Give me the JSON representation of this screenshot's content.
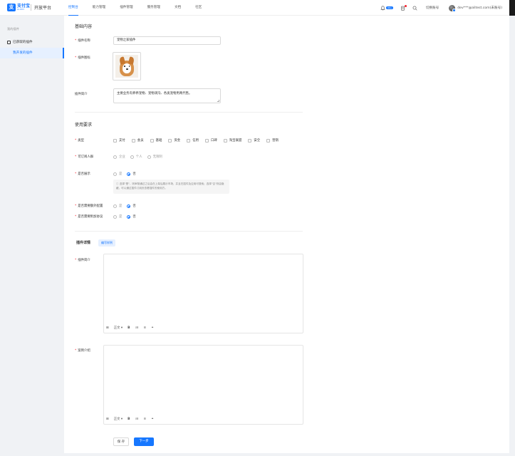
{
  "header": {
    "logo_glyph": "支",
    "logo_name": "支付宝",
    "logo_sub": "ALIPAY",
    "platform": "开放平台",
    "nav": [
      "控制台",
      "能力管理",
      "插件管理",
      "服务管理",
      "文档",
      "社区"
    ],
    "active_nav": 0,
    "msg_badge": "99+",
    "switch_account": "切换账号",
    "user": "dev***@alitest.com(未账号)"
  },
  "sidebar": {
    "group": "我的插件",
    "items": [
      "已获取的插件",
      "我开发的插件"
    ],
    "active": 1
  },
  "basic": {
    "title": "基础内容",
    "name_label": "插件名称",
    "name_value": "宠物之家插件",
    "icon_label": "插件图标",
    "intro_label": "插件简介",
    "intro_value": "主要业务有养养宠物、宠物调沟、各类宠物用两代售。"
  },
  "usage": {
    "title": "使用要求",
    "type_label": "类型",
    "types": [
      "支付",
      "会员",
      "基础",
      "资金",
      "信用",
      "口碑",
      "淘宝联盟",
      "安全",
      "营销"
    ],
    "subscriber_label": "可订阅人群",
    "subscribers": [
      "企业",
      "个人",
      "无限制"
    ],
    "display_label": "是否展示",
    "yes": "是",
    "no": "否",
    "display_note": "选择\"是\"，则审核通过之后会在上架后展示市场，并且在插件及应用可搜索；选择\"否\"则会隐藏，可以通过插件订阅页查看插件的使用方。",
    "config_label": "是否需要额外配置",
    "agreement_label": "是否需要附加协议"
  },
  "detail": {
    "title": "插件详情",
    "example_btn": "编写样例",
    "intro_label": "插件简介",
    "case_label": "案例介绍",
    "toolbar_para": "正文"
  },
  "footer": {
    "save": "保 存",
    "next": "下一步"
  }
}
